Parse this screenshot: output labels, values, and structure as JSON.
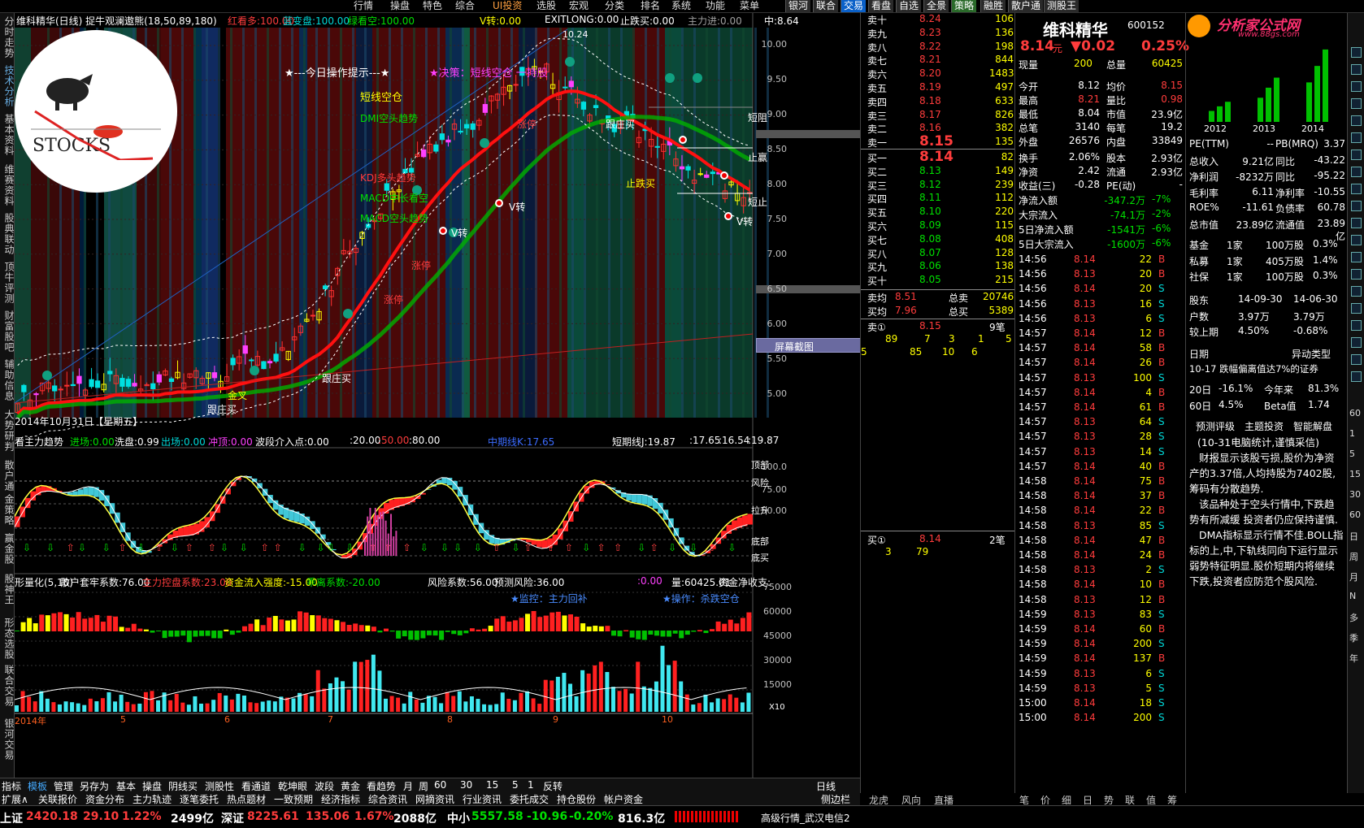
{
  "menu": {
    "items": [
      "行情",
      "操盘",
      "特色",
      "综合",
      "UI投资",
      "选股",
      "宏观",
      "分类",
      "排名",
      "系统",
      "功能",
      "菜单"
    ],
    "right": [
      "银河",
      "联合",
      "交易",
      "看盘",
      "自选",
      "全景",
      "策略",
      "融胜",
      "散户通",
      "测股王"
    ],
    "logo": "分析家公式网",
    "logo_url": "www.88gs.com"
  },
  "leftnav": [
    "分时走势",
    "技术分析",
    "基本资料",
    "维赛资料",
    "股典联动",
    "顶牛评测",
    "财富股吧",
    "辅助信息",
    "大势研判",
    "散户通",
    "金策略",
    "赢金股",
    "股神王",
    "形态选股",
    "联合交易",
    "银河交易"
  ],
  "main_header": {
    "title": "维科精华(日线) 捉牛观澜遨熊(18,50,89,180)",
    "hong_label": "红看多:",
    "hong_val": "100.00",
    "lan_label": "蓝变盘:",
    "lan_val": "100.00",
    "lv_label": "绿看空:",
    "lv_val": "100.00",
    "vzhuan": "V转:0.00",
    "exitlong": "EXITLONG:0.00",
    "zhidie": "止跌买:0.00",
    "zhuli": "主力进:0.00",
    "zhong": "中:8.64"
  },
  "annotations": {
    "op_tip": "★---今日操作提示---★",
    "decision": "★决策：短线空仓 一持股",
    "short_empty": "短线空仓",
    "dmi": "DMI空头趋势",
    "kdj": "KDJ多头趋势",
    "macd1": "MACD中长看空",
    "macd2": "MACD空头趋势",
    "date_label": "2014年10月31日【星期五】",
    "logo_text": "STOCKS",
    "peak": "10.24",
    "gen_zhuang": "跟庄买",
    "zhang_ting": "涨停",
    "v_zhuan": "V转",
    "zhidie_mai": "止跌买",
    "jin_cha": "金叉",
    "duan_zu": "短阻",
    "zhi_ying": "止赢",
    "duan_zhi": "短止",
    "screenshot_btn": "屏幕截图"
  },
  "price_axis": [
    "10.00",
    "9.50",
    "9.00",
    "8.50",
    "8.00",
    "7.50",
    "7.00",
    "6.50",
    "6.00",
    "5.50",
    "5.00"
  ],
  "mid_header": {
    "name": "看主力趋势",
    "jinchang": "进场:0.00",
    "xipan": "洗盘:0.99",
    "chuchang": "出场:0.00",
    "chongding": "冲顶:0.00",
    "boduan": "波段介入点:0.00",
    "v20": ":20.00",
    "v50": ":50.00",
    "v80": ":80.00",
    "zhong": "中期线K:17.65",
    "duanqi": "短期线J:19.87",
    "v1": ":17.65",
    "v2": ":16.54",
    "v3": ":19.87"
  },
  "mid_axis": [
    "100.0",
    "75.00",
    "50.00"
  ],
  "mid_labels": [
    "顶部",
    "风险",
    "拉升",
    "底部",
    "底买"
  ],
  "low_header": {
    "name": "形量化(5,10)",
    "sanhu": "散户套牢系数:76.00",
    "zhuli": "主力控盘系数:23.00",
    "zijin": "资金流入强度:-15.00",
    "guli": "乖离系数:-20.00",
    "fengxian": "风险系数:56.00",
    "yuce": "预测风险:36.00",
    "v0": ":0.00",
    "liang": "量:60425.01",
    "jinge": "资金净收支:"
  },
  "low_notes": {
    "jiankong": "★监控：主力回补",
    "caozuo": "★操作：杀跌空仓"
  },
  "low_axis": [
    "75000",
    "60000",
    "45000",
    "30000",
    "15000"
  ],
  "x_axis": [
    "2014年",
    "5",
    "6",
    "7",
    "8",
    "9",
    "10"
  ],
  "x10": "X10",
  "bottom_tabs": [
    "指标",
    "模板",
    "管理",
    "另存为",
    "基本",
    "操盘",
    "阴线买",
    "测股性",
    "看通道",
    "乾坤眼",
    "波段",
    "黄金",
    "看趋势",
    "月",
    "周",
    "60",
    "30",
    "15",
    "5",
    "1",
    "反转",
    "日线"
  ],
  "bottom_tabs2": [
    "扩展∧",
    "关联报价",
    "资金分布",
    "主力轨迹",
    "逐笔委托",
    "热点题材",
    "一致预期",
    "经济指标",
    "综合资讯",
    "网摘资讯",
    "行业资讯",
    "委托成交",
    "持仓股份",
    "帐户资金",
    "侧边栏"
  ],
  "quote": {
    "name": "维科精华",
    "code": "600152",
    "price": "8.14",
    "yuan": "元",
    "chg": "▼0.02",
    "pct": "0.25%",
    "sells": [
      [
        "卖十",
        "8.24",
        "106"
      ],
      [
        "卖九",
        "8.23",
        "136"
      ],
      [
        "卖八",
        "8.22",
        "198"
      ],
      [
        "卖七",
        "8.21",
        "844"
      ],
      [
        "卖六",
        "8.20",
        "1483"
      ],
      [
        "卖五",
        "8.19",
        "497"
      ],
      [
        "卖四",
        "8.18",
        "633"
      ],
      [
        "卖三",
        "8.17",
        "826"
      ],
      [
        "卖二",
        "8.16",
        "382"
      ],
      [
        "卖一",
        "8.15",
        "135"
      ]
    ],
    "buys": [
      [
        "买一",
        "8.14",
        "82"
      ],
      [
        "买二",
        "8.13",
        "149"
      ],
      [
        "买三",
        "8.12",
        "239"
      ],
      [
        "买四",
        "8.11",
        "112"
      ],
      [
        "买五",
        "8.10",
        "220"
      ],
      [
        "买六",
        "8.09",
        "115"
      ],
      [
        "买七",
        "8.08",
        "408"
      ],
      [
        "买八",
        "8.07",
        "128"
      ],
      [
        "买九",
        "8.06",
        "138"
      ],
      [
        "买十",
        "8.05",
        "215"
      ]
    ],
    "xianliang_label": "现量",
    "xianliang": "200",
    "zongliang_label": "总量",
    "zongliang": "60425",
    "stats": [
      [
        "今开",
        "8.12",
        "均价",
        "8.15"
      ],
      [
        "最高",
        "8.21",
        "量比",
        "0.98"
      ],
      [
        "最低",
        "8.04",
        "市值",
        "23.9亿"
      ],
      [
        "总笔",
        "3140",
        "每笔",
        "19.2"
      ],
      [
        "外盘",
        "26576",
        "内盘",
        "33849"
      ]
    ],
    "stats2": [
      [
        "换手",
        "2.06%",
        "股本",
        "2.93亿"
      ],
      [
        "净资",
        "2.42",
        "流通",
        "2.93亿"
      ],
      [
        "收益(三)",
        "-0.28",
        "PE(动)",
        "-"
      ]
    ],
    "flows": [
      [
        "净流入额",
        "-347.2万",
        "-7%"
      ],
      [
        "大宗流入",
        "-74.1万",
        "-2%"
      ],
      [
        "5日净流入额",
        "-1541万",
        "-6%"
      ],
      [
        "5日大宗流入",
        "-1600万",
        "-6%"
      ]
    ],
    "junmai": [
      [
        "卖均",
        "8.51",
        "总卖",
        "20746"
      ],
      [
        "买均",
        "7.96",
        "总买",
        "5389"
      ]
    ],
    "sell1": [
      "卖①",
      "8.15",
      "9笔"
    ],
    "sell1_q": [
      "89",
      "7",
      "3",
      "1",
      "5"
    ],
    "sell1_q2": [
      "5",
      "85",
      "10",
      "6"
    ],
    "buy1": [
      "买①",
      "8.14",
      "2笔"
    ],
    "buy1_q": [
      "3",
      "79"
    ]
  },
  "ticks": [
    [
      "14:56",
      "8.14",
      "22",
      "B"
    ],
    [
      "14:56",
      "8.13",
      "20",
      "B"
    ],
    [
      "14:56",
      "8.14",
      "20",
      "S"
    ],
    [
      "14:56",
      "8.13",
      "16",
      "S"
    ],
    [
      "14:56",
      "8.13",
      "6",
      "S"
    ],
    [
      "14:57",
      "8.14",
      "12",
      "B"
    ],
    [
      "14:57",
      "8.14",
      "58",
      "B"
    ],
    [
      "14:57",
      "8.14",
      "26",
      "B"
    ],
    [
      "14:57",
      "8.13",
      "100",
      "S"
    ],
    [
      "14:57",
      "8.14",
      "4",
      "B"
    ],
    [
      "14:57",
      "8.14",
      "61",
      "B"
    ],
    [
      "14:57",
      "8.13",
      "64",
      "S"
    ],
    [
      "14:57",
      "8.13",
      "28",
      "S"
    ],
    [
      "14:57",
      "8.13",
      "14",
      "S"
    ],
    [
      "14:57",
      "8.14",
      "40",
      "B"
    ],
    [
      "14:58",
      "8.14",
      "75",
      "B"
    ],
    [
      "14:58",
      "8.14",
      "37",
      "B"
    ],
    [
      "14:58",
      "8.14",
      "22",
      "B"
    ],
    [
      "14:58",
      "8.13",
      "85",
      "S"
    ],
    [
      "14:58",
      "8.14",
      "47",
      "B"
    ],
    [
      "14:58",
      "8.14",
      "24",
      "B"
    ],
    [
      "14:58",
      "8.13",
      "2",
      "S"
    ],
    [
      "14:58",
      "8.14",
      "10",
      "B"
    ],
    [
      "14:58",
      "8.13",
      "12",
      "B"
    ],
    [
      "14:59",
      "8.13",
      "83",
      "S"
    ],
    [
      "14:59",
      "8.14",
      "60",
      "B"
    ],
    [
      "14:59",
      "8.14",
      "200",
      "S"
    ],
    [
      "14:59",
      "8.14",
      "137",
      "B"
    ],
    [
      "14:59",
      "8.13",
      "6",
      "S"
    ],
    [
      "14:59",
      "8.13",
      "5",
      "S"
    ],
    [
      "15:00",
      "8.14",
      "18",
      "S"
    ],
    [
      "15:00",
      "8.14",
      "200",
      "S"
    ]
  ],
  "info": {
    "title": "分析家公式网",
    "url": "www.88gs.com",
    "years": [
      "2012",
      "2013",
      "2014"
    ],
    "bars": [
      0.25,
      0.55,
      0.9
    ],
    "fund": [
      [
        "PE(TTM)",
        "--",
        "PB(MRQ)",
        "3.37"
      ],
      [
        "总收入",
        "9.21亿",
        "同比",
        "-43.22"
      ],
      [
        "净利润",
        "-8232万",
        "同比",
        "-95.22"
      ],
      [
        "毛利率",
        "6.11",
        "净利率",
        "-10.55"
      ],
      [
        "ROE%",
        "-11.61",
        "负债率",
        "60.78"
      ],
      [
        "总市值",
        "23.89亿",
        "流通值",
        "23.89亿"
      ]
    ],
    "holders": [
      [
        "基金",
        "1家",
        "100万股",
        "0.3%"
      ],
      [
        "私募",
        "1家",
        "405万股",
        "1.4%"
      ],
      [
        "社保",
        "1家",
        "100万股",
        "0.3%"
      ]
    ],
    "gudong": [
      [
        "股东",
        "14-09-30",
        "14-06-30"
      ],
      [
        "户数",
        "3.97万",
        "3.79万"
      ],
      [
        "较上期",
        "4.50%",
        "-0.68%"
      ]
    ],
    "riqi": [
      "日期",
      "异动类型"
    ],
    "yidong": "10-17 跌幅偏离值达7%的证券",
    "perf": [
      [
        "20日",
        "-16.1%",
        "今年来",
        "81.3%"
      ],
      [
        "60日",
        "4.5%",
        "Beta值",
        "1.74"
      ]
    ],
    "pingji": [
      "预测评级",
      "主题投资",
      "智能解盘"
    ],
    "comment": [
      "(10-31电脑统计,谨慎采信)",
      "财报显示该股亏损,股价为净资产的3.37倍,人均持股为7402股,筹码有分散趋势.",
      "该品种处于空头行情中,下跌趋势有所减缓 投资者仍应保持谨慎.",
      "DMA指标显示行情不佳.BOLL指标的上,中,下轨线同向下运行显示弱势特征明显.股价短期内将继续下跌,投资者应防范个股风险."
    ]
  },
  "ticks_tabs": [
    "队列",
    "分布",
    "龙虎",
    "风向",
    "直播"
  ],
  "info_tabs": [
    "笔",
    "价",
    "细",
    "日",
    "势",
    "联",
    "值",
    "筹"
  ],
  "rightnav": [
    "60",
    "1",
    "5",
    "15",
    "30",
    "60",
    "日",
    "周",
    "月",
    "N",
    "多",
    "季",
    "年"
  ],
  "status": {
    "sh_label": "上证",
    "sh": "2420.18",
    "sh_chg": "29.10",
    "sh_pct": "1.22%",
    "sh_amt": "2499亿",
    "sz_label": "深证",
    "sz": "8225.61",
    "sz_chg": "135.06",
    "sz_pct": "1.67%",
    "sz_amt": "2088亿",
    "zx_label": "中小",
    "zx": "5557.58",
    "zx_chg": "-10.96",
    "zx_pct": "-0.20%",
    "zx_amt": "816.3亿",
    "server": "高级行情_武汉电信2"
  }
}
